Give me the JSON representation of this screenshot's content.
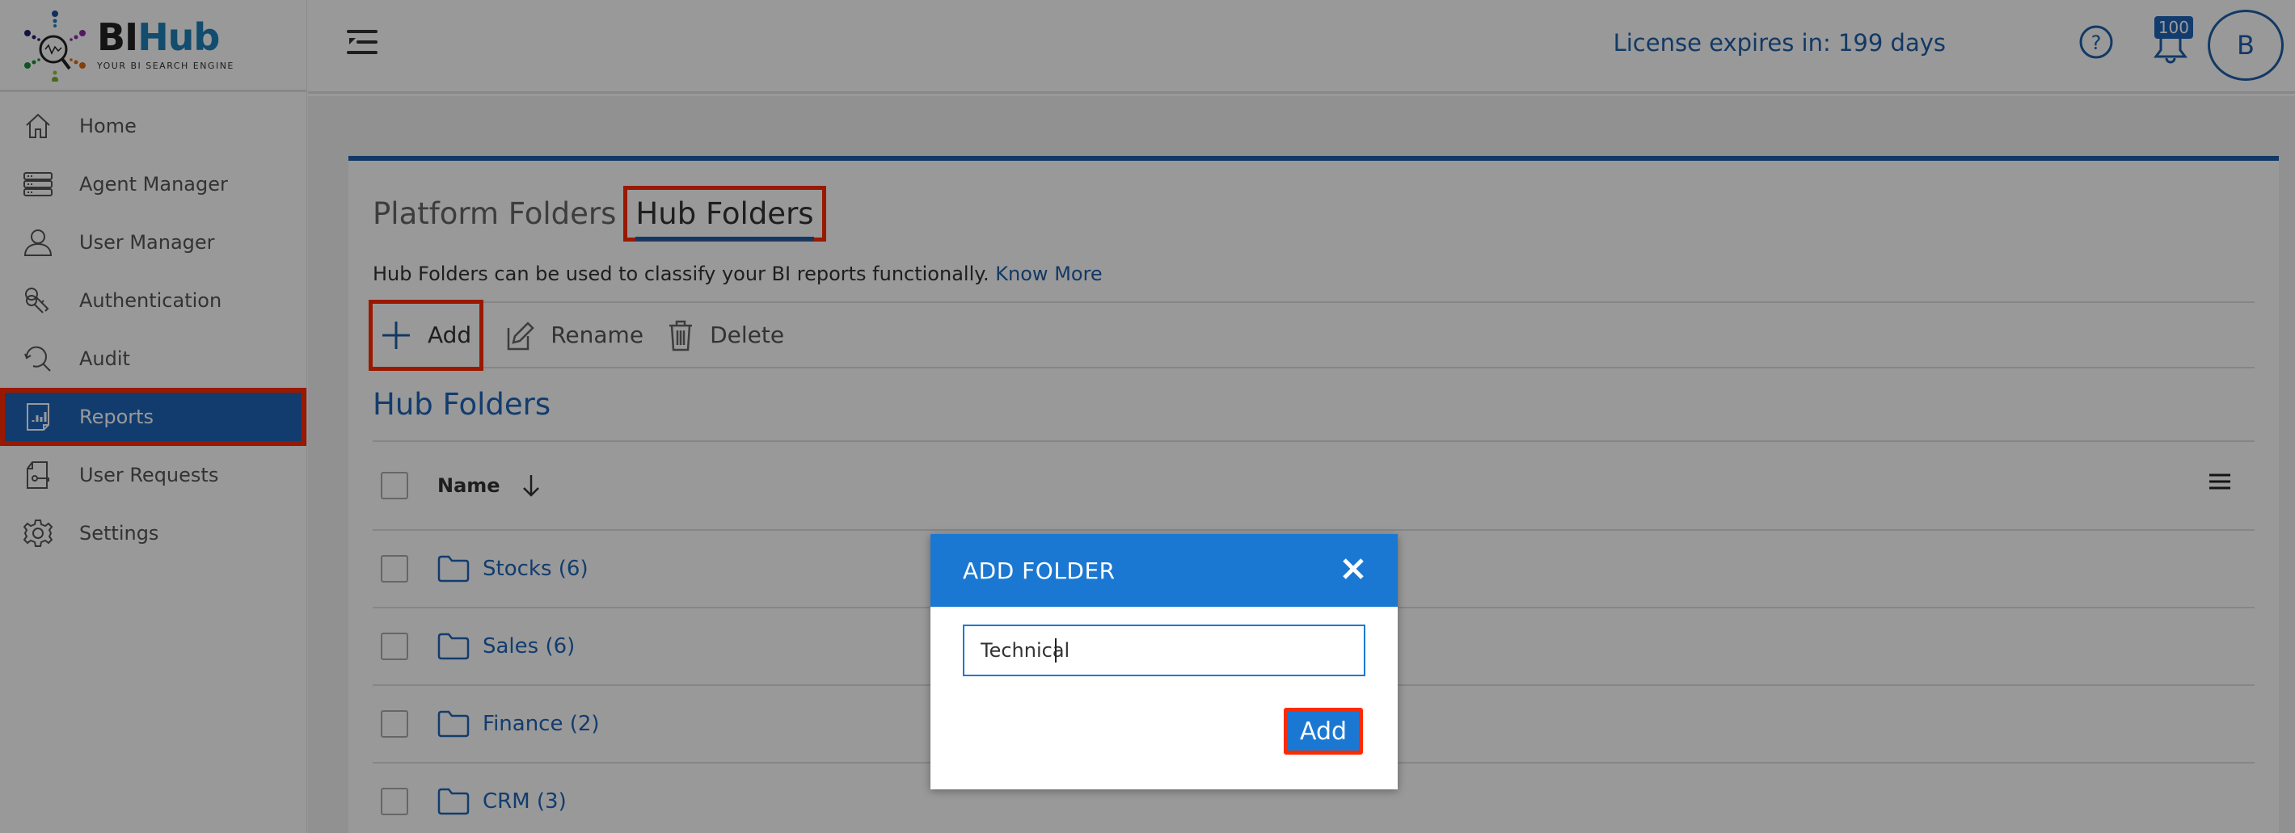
{
  "app": {
    "logo": {
      "title_part1": "BI",
      "title_part2": "Hub",
      "tagline": "YOUR BI SEARCH ENGINE"
    }
  },
  "sidebar": {
    "items": [
      {
        "label": "Home",
        "icon": "home-icon",
        "active": false
      },
      {
        "label": "Agent Manager",
        "icon": "server-icon",
        "active": false
      },
      {
        "label": "User Manager",
        "icon": "user-icon",
        "active": false
      },
      {
        "label": "Authentication",
        "icon": "keys-icon",
        "active": false
      },
      {
        "label": "Audit",
        "icon": "audit-search-icon",
        "active": false
      },
      {
        "label": "Reports",
        "icon": "report-icon",
        "active": true
      },
      {
        "label": "User Requests",
        "icon": "request-key-icon",
        "active": false
      },
      {
        "label": "Settings",
        "icon": "gear-icon",
        "active": false
      }
    ]
  },
  "header": {
    "license_text": "License expires in: 199 days",
    "notification_count": "100",
    "avatar_initial": "B"
  },
  "main": {
    "tabs": [
      {
        "label": "Platform Folders",
        "active": false
      },
      {
        "label": "Hub Folders",
        "active": true
      }
    ],
    "description": "Hub Folders can be used to classify your BI reports functionally.",
    "know_more": "Know More",
    "toolbar": {
      "add": "Add",
      "rename": "Rename",
      "delete": "Delete"
    },
    "section_title": "Hub Folders",
    "table": {
      "column_name": "Name",
      "rows": [
        {
          "label": "Stocks (6)"
        },
        {
          "label": "Sales (6)"
        },
        {
          "label": "Finance (2)"
        },
        {
          "label": "CRM (3)"
        }
      ]
    }
  },
  "modal": {
    "title": "ADD FOLDER",
    "input_value": "Technical",
    "add_button": "Add"
  },
  "colors": {
    "brand_blue": "#1f5fa8",
    "modal_blue": "#1b78d2",
    "highlight_red": "#ff2a00"
  }
}
